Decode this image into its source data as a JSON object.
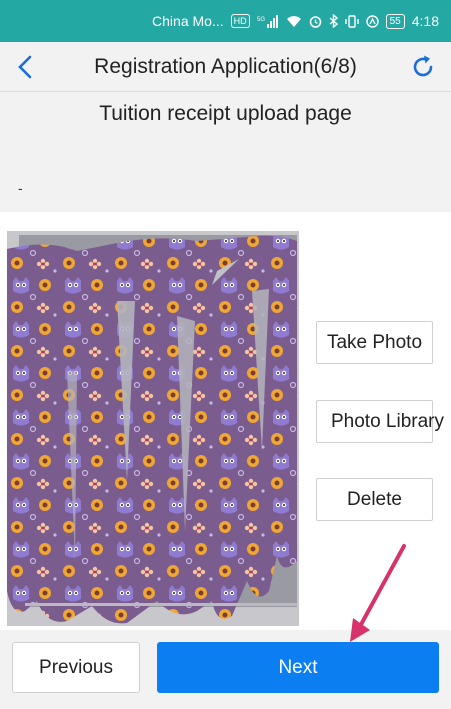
{
  "status_bar": {
    "carrier": "China Mo...",
    "hd_badge": "HD",
    "network_badge": "5G",
    "battery": "55",
    "time": "4:18"
  },
  "nav": {
    "title": "Registration Application(6/8)",
    "back_icon": "chevron-left-icon",
    "refresh_icon": "refresh-icon"
  },
  "page": {
    "heading": "Tuition receipt upload page",
    "dash": "-"
  },
  "actions": {
    "take_photo": "Take Photo",
    "photo_library": "Photo Library",
    "delete": "Delete"
  },
  "footer": {
    "previous": "Previous",
    "next": "Next"
  },
  "colors": {
    "status_bar": "#24a8a4",
    "primary": "#0b7ef1",
    "arrow": "#d6336c",
    "pattern_bg": "#7a5c8e",
    "owl": "#8f7bd0",
    "flower": "#f0a734"
  }
}
